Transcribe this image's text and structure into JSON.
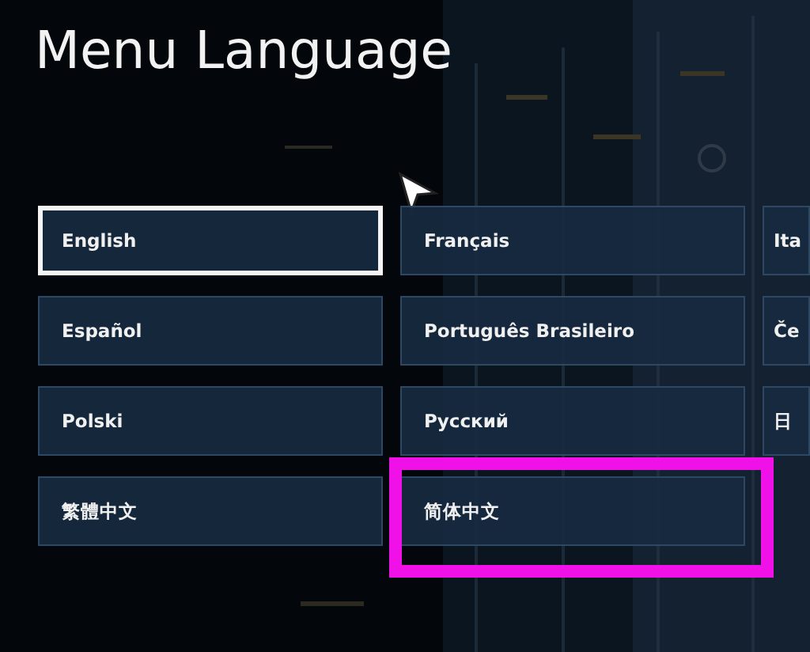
{
  "title": "Menu Language",
  "languages": [
    {
      "label": "English",
      "selected": true,
      "highlighted": false
    },
    {
      "label": "Français",
      "selected": false,
      "highlighted": false
    },
    {
      "label": "Ita",
      "selected": false,
      "highlighted": false
    },
    {
      "label": "Español",
      "selected": false,
      "highlighted": false
    },
    {
      "label": "Português Brasileiro",
      "selected": false,
      "highlighted": false
    },
    {
      "label": "Če",
      "selected": false,
      "highlighted": false
    },
    {
      "label": "Polski",
      "selected": false,
      "highlighted": false
    },
    {
      "label": "Русский",
      "selected": false,
      "highlighted": false
    },
    {
      "label": "日",
      "selected": false,
      "highlighted": false
    },
    {
      "label": "繁體中文",
      "selected": false,
      "highlighted": false
    },
    {
      "label": "简体中文",
      "selected": false,
      "highlighted": true
    }
  ]
}
